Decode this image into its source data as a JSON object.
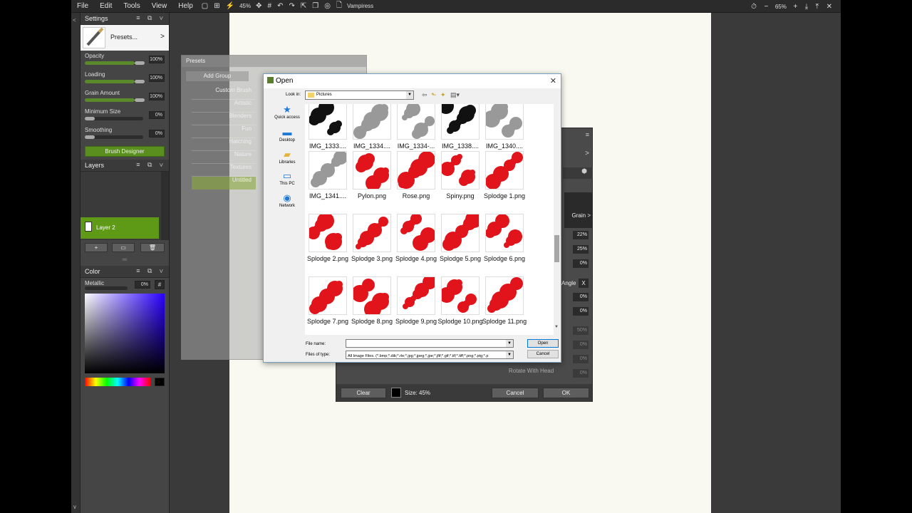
{
  "menu": {
    "file": "File",
    "edit": "Edit",
    "tools": "Tools",
    "view": "View",
    "help": "Help"
  },
  "toolbar": {
    "zoom": "45%",
    "doc_name": "Vampiress",
    "right_zoom": "65%"
  },
  "settings": {
    "title": "Settings",
    "presets_label": "Presets...",
    "presets_arrow": ">",
    "opacity": {
      "label": "Opacity",
      "value": "100%"
    },
    "loading": {
      "label": "Loading",
      "value": "100%"
    },
    "grain": {
      "label": "Grain Amount",
      "value": "100%"
    },
    "min_size": {
      "label": "Minimum Size",
      "value": "0%"
    },
    "smoothing": {
      "label": "Smoothing",
      "value": "0%"
    },
    "brush_designer": "Brush Designer"
  },
  "layers": {
    "title": "Layers",
    "layer_name": "Layer 2",
    "add": "+"
  },
  "color": {
    "title": "Color",
    "metallic": "Metallic",
    "metallic_value": "0%",
    "hash": "#"
  },
  "presets_panel": {
    "title": "Presets",
    "add_group": "Add Group",
    "items": [
      "Custom Brush",
      "Artistic",
      "Blenders",
      "Fun",
      "Hatching",
      "Nature",
      "Textures",
      "Untitled"
    ]
  },
  "brush_designer": {
    "arrow": ">",
    "grain_label": "Grain >",
    "vals": [
      "22%",
      "25%",
      "0%",
      "0%",
      "0%",
      "50%",
      "0%",
      "0%",
      "0%"
    ],
    "angle": "Angle",
    "angle_x": "X",
    "rotate_with_head": "Rotate With Head",
    "clear": "Clear",
    "size_label": "Size: 45%",
    "cancel": "Cancel",
    "ok": "OK"
  },
  "open_dialog": {
    "title": "Open",
    "look_in_label": "Look in:",
    "look_in_value": "Pictures",
    "nav": [
      "Quick access",
      "Desktop",
      "Libraries",
      "This PC",
      "Network"
    ],
    "files": [
      [
        "IMG_1333....",
        "IMG_1334....",
        "IMG_1334-...",
        "IMG_1338....",
        "IMG_1340...."
      ],
      [
        "IMG_1341....",
        "Pylon.png",
        "Rose.png",
        "Spiny.png",
        "Splodge 1.png"
      ],
      [
        "Splodge 2.png",
        "Splodge 3.png",
        "Splodge 4.png",
        "Splodge 5.png",
        "Splodge 6.png"
      ],
      [
        "Splodge 7.png",
        "Splodge 8.png",
        "Splodge 9.png",
        "Splodge 10.png",
        "Splodge 11.png"
      ]
    ],
    "file_name_label": "File name:",
    "file_name_value": "",
    "file_type_label": "Files of type:",
    "file_type_value": "All Image Files. (*.bmp;*.dib;*.rle;*.jpg;*.jpeg;*.jpe;*.jfif;*.gif;*.tif;*.tiff;*.png;*.ptg;*.p",
    "open_btn": "Open",
    "cancel_btn": "Cancel"
  }
}
